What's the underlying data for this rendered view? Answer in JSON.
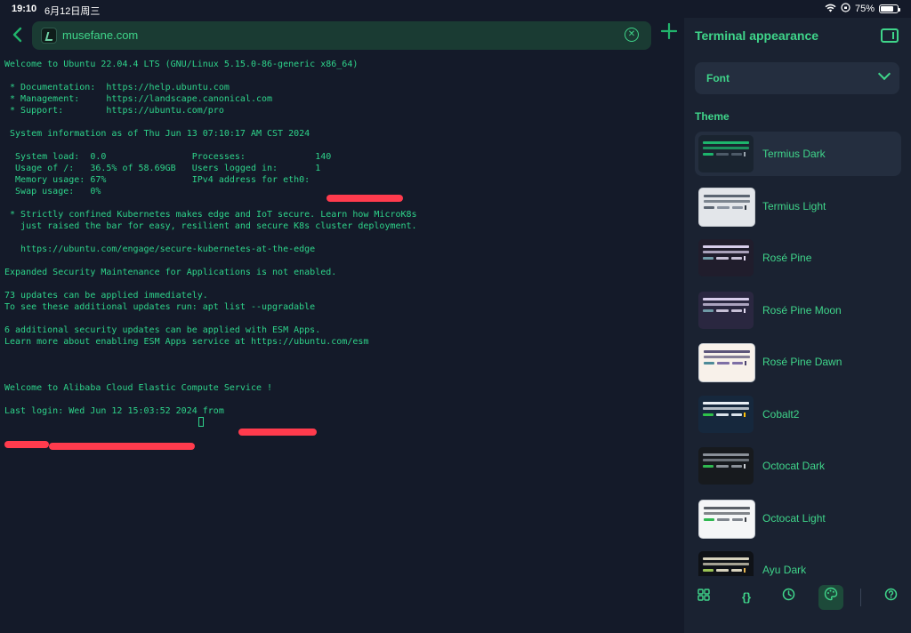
{
  "status": {
    "time": "19:10",
    "date": "6月12日周三",
    "battery": "75%",
    "battery_level": 0.75
  },
  "browser": {
    "url": "musefane.com"
  },
  "terminal": {
    "lines": [
      "Welcome to Ubuntu 22.04.4 LTS (GNU/Linux 5.15.0-86-generic x86_64)",
      "",
      " * Documentation:  https://help.ubuntu.com",
      " * Management:     https://landscape.canonical.com",
      " * Support:        https://ubuntu.com/pro",
      "",
      " System information as of Thu Jun 13 07:10:17 AM CST 2024",
      "",
      "  System load:  0.0                Processes:             140",
      "  Usage of /:   36.5% of 58.69GB   Users logged in:       1",
      "  Memory usage: 67%                IPv4 address for eth0: ",
      "  Swap usage:   0%",
      "",
      " * Strictly confined Kubernetes makes edge and IoT secure. Learn how MicroK8s",
      "   just raised the bar for easy, resilient and secure K8s cluster deployment.",
      "",
      "   https://ubuntu.com/engage/secure-kubernetes-at-the-edge",
      "",
      "Expanded Security Maintenance for Applications is not enabled.",
      "",
      "73 updates can be applied immediately.",
      "To see these additional updates run: apt list --upgradable",
      "",
      "6 additional security updates can be applied with ESM Apps.",
      "Learn more about enabling ESM Apps service at https://ubuntu.com/esm",
      "",
      "",
      "",
      "Welcome to Alibaba Cloud Elastic Compute Service !",
      "",
      "Last login: Wed Jun 12 15:03:52 2024 from "
    ]
  },
  "sidebar": {
    "title": "Terminal appearance",
    "font_label": "Font",
    "theme_heading": "Theme",
    "themes": [
      {
        "name": "Termius Dark",
        "bg": "#1a2430",
        "b1": "#1db46c",
        "b2": "#1db46c",
        "acc": "#1db46c",
        "mid": "#4d5a68",
        "end": "#9aa4ae"
      },
      {
        "name": "Termius Light",
        "bg": "#e3e6ea",
        "b1": "#5b6572",
        "b2": "#5b6572",
        "acc": "#5b6572",
        "mid": "#8a93a0",
        "end": "#2f3640"
      },
      {
        "name": "Rosé Pine",
        "bg": "#201d2c",
        "b1": "#d7cdea",
        "b2": "#d7cdea",
        "acc": "#6f9aa6",
        "mid": "#c7c0d6",
        "end": "#e0d8ee"
      },
      {
        "name": "Rosé Pine Moon",
        "bg": "#2a2740",
        "b1": "#d7cdea",
        "b2": "#d7cdea",
        "acc": "#6f9aa6",
        "mid": "#c7c0d6",
        "end": "#e0d8ee"
      },
      {
        "name": "Rosé Pine Dawn",
        "bg": "#f8f1ea",
        "b1": "#5d557a",
        "b2": "#5d557a",
        "acc": "#4e8a98",
        "mid": "#7e6fa5",
        "end": "#4e4670"
      },
      {
        "name": "Cobalt2",
        "bg": "#16283d",
        "b1": "#e8eef4",
        "b2": "#e8eef4",
        "acc": "#2ec24a",
        "mid": "#d9e2ea",
        "end": "#ffc107"
      },
      {
        "name": "Octocat Dark",
        "bg": "#171a1e",
        "b1": "#8a9098",
        "b2": "#8a9098",
        "acc": "#2fb850",
        "mid": "#8a9098",
        "end": "#c8ccd1"
      },
      {
        "name": "Octocat Light",
        "bg": "#f5f6f7",
        "b1": "#5a5f66",
        "b2": "#5a5f66",
        "acc": "#2fb850",
        "mid": "#7f858d",
        "end": "#3c4046"
      },
      {
        "name": "Ayu Dark",
        "bg": "#0f1217",
        "b1": "#d8d3bd",
        "b2": "#d8d3bd",
        "acc": "#9ac254",
        "mid": "#d8d3bd",
        "end": "#e6b450"
      }
    ]
  },
  "bottom_icons": [
    "grid-icon",
    "braces-icon",
    "history-icon",
    "palette-icon",
    "help-icon"
  ],
  "colors": {
    "accent": "#3fd58a",
    "terminal_text": "#2ed38a",
    "redaction": "#ff3b4d"
  }
}
